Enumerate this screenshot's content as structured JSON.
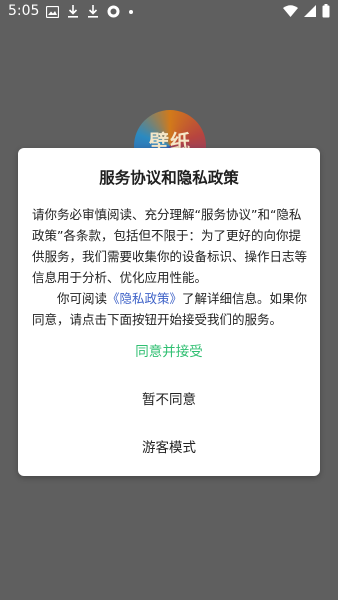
{
  "status_bar": {
    "time": "5:05"
  },
  "app": {
    "logo_text": "壁纸"
  },
  "dialog": {
    "title": "服务协议和隐私政策",
    "paragraph1": "请你务必审慎阅读、充分理解“服务协议”和“隐私政策”各条款，包括但不限于：为了更好的向你提供服务，我们需要收集你的设备标识、操作日志等信息用于分析、优化应用性能。",
    "paragraph2_before": "你可阅读",
    "policy_link": "《隐私政策》",
    "paragraph2_after": "了解详细信息。如果你同意，请点击下面按钮开始接受我们的服务。",
    "agree_label": "同意并接受",
    "decline_label": "暂不同意",
    "guest_label": "游客模式"
  },
  "colors": {
    "overlay": "#5f5f5f",
    "dialog_bg": "#ffffff",
    "agree_text": "#2fbf71",
    "link_text": "#3f63c8"
  }
}
